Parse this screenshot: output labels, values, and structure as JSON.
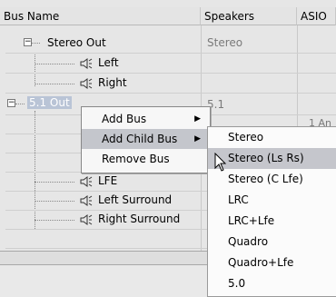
{
  "header": {
    "bus_name": "Bus Name",
    "speakers": "Speakers",
    "asio": "ASIO"
  },
  "rows": [
    {
      "name": "Stereo Out",
      "speakers": "Stereo",
      "asio": ""
    },
    {
      "name": "Left",
      "speakers": "",
      "asio": ""
    },
    {
      "name": "Right",
      "speakers": "",
      "asio": ""
    },
    {
      "name": "5.1 Out",
      "speakers": "5.1",
      "asio": ""
    },
    {
      "name": "",
      "speakers": "",
      "asio": "1 An"
    },
    {
      "name": "",
      "speakers": "",
      "asio": ""
    },
    {
      "name": "",
      "speakers": "",
      "asio": ""
    },
    {
      "name": "LFE",
      "speakers": "",
      "asio": ""
    },
    {
      "name": "Left Surround",
      "speakers": "",
      "asio": ""
    },
    {
      "name": "Right Surround",
      "speakers": "",
      "asio": ""
    }
  ],
  "context_menu": {
    "items": [
      "Add Bus",
      "Add Child Bus",
      "Remove Bus"
    ]
  },
  "submenu": {
    "items": [
      "Stereo",
      "Stereo (Ls Rs)",
      "Stereo (C Lfe)",
      "LRC",
      "LRC+Lfe",
      "Quadro",
      "Quadro+Lfe",
      "5.0"
    ]
  },
  "icons": {
    "expander_collapse": "minus-box-icon",
    "speaker": "speaker-icon",
    "submenu_arrow": "triangle-right-icon",
    "cursor": "arrow-cursor-icon"
  }
}
